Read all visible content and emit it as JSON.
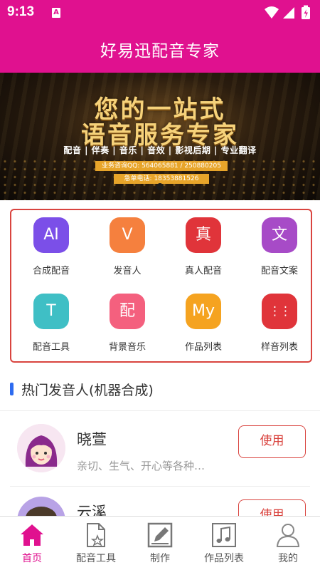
{
  "status": {
    "time": "9:13",
    "notification_badge": "A"
  },
  "header": {
    "title": "好易迅配音专家"
  },
  "banner": {
    "headline_line1": "您的一站式",
    "headline_line2": "语音服务专家",
    "services": "配音 | 伴奏 | 音乐 | 音效 | 影视后期 | 专业翻译",
    "qq": "业务咨询QQ: 564065881 / 250880205",
    "phone": "急单电话: 18353881526"
  },
  "features": [
    {
      "label": "合成配音",
      "glyph": "AI",
      "color": "#7b4fe8",
      "icon": "ai-icon"
    },
    {
      "label": "发音人",
      "glyph": "V",
      "color": "#f5803e",
      "icon": "voice-icon"
    },
    {
      "label": "真人配音",
      "glyph": "真",
      "color": "#e0343a",
      "icon": "real-voice-icon"
    },
    {
      "label": "配音文案",
      "glyph": "文",
      "color": "#a74bc7",
      "icon": "script-icon"
    },
    {
      "label": "配音工具",
      "glyph": "T",
      "color": "#3fbfc5",
      "icon": "tool-icon"
    },
    {
      "label": "背景音乐",
      "glyph": "配",
      "color": "#f4607e",
      "icon": "bgm-icon"
    },
    {
      "label": "作品列表",
      "glyph": "My",
      "color": "#f5a320",
      "icon": "works-icon"
    },
    {
      "label": "样音列表",
      "glyph": "⋮⋮",
      "color": "#e0343a",
      "icon": "samples-icon"
    }
  ],
  "section": {
    "title": "热门发音人(机器合成)"
  },
  "speakers": [
    {
      "name": "晓萱",
      "desc": "亲切、生气、开心等各种…",
      "button": "使用"
    },
    {
      "name": "云溪",
      "desc": "",
      "button": "使用"
    }
  ],
  "tabs": [
    {
      "label": "首页",
      "icon": "home-icon",
      "active": true
    },
    {
      "label": "配音工具",
      "icon": "document-star-icon",
      "active": false
    },
    {
      "label": "制作",
      "icon": "edit-icon",
      "active": false
    },
    {
      "label": "作品列表",
      "icon": "music-note-icon",
      "active": false
    },
    {
      "label": "我的",
      "icon": "user-icon",
      "active": false
    }
  ],
  "colors": {
    "brand": "#e0118f",
    "accent_red": "#d9443f",
    "section_marker": "#2d6bf0"
  }
}
